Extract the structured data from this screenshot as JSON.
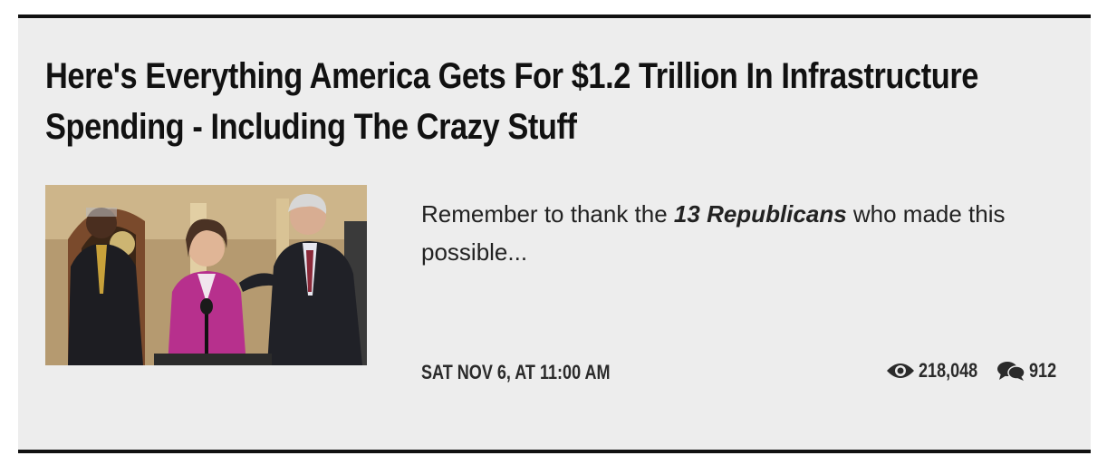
{
  "article": {
    "title": "Here's Everything America Gets For $1.2 Trillion In Infrastructure Spending - Including The Crazy Stuff",
    "excerpt_before": "Remember to thank the ",
    "excerpt_emphasis": "13 Republicans",
    "excerpt_after": " who made this possible...",
    "date": "SAT NOV 6, AT 11:00 AM",
    "views": "218,048",
    "comments": "912",
    "icons": {
      "views": "eye-icon",
      "comments": "chat-bubbles-icon"
    }
  }
}
